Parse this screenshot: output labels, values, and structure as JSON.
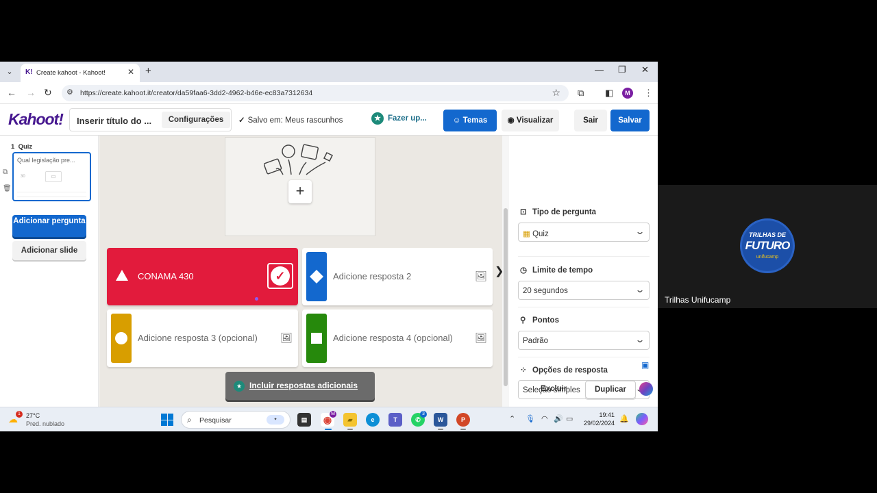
{
  "browser": {
    "tab_title": "Create kahoot - Kahoot!",
    "tab_favicon": "K!",
    "url": "https://create.kahoot.it/creator/da59faa6-3dd2-4962-b46e-ec83a7312634",
    "profile_initial": "M"
  },
  "header": {
    "logo": "Kahoot!",
    "title_placeholder": "Inserir título do ...",
    "settings_label": "Configurações",
    "saved_status": "Salvo em: Meus rascunhos",
    "upgrade_label": "Fazer up...",
    "themes_label": "Temas",
    "preview_label": "Visualizar",
    "exit_label": "Sair",
    "save_label": "Salvar"
  },
  "sidebar": {
    "slide_number": "1",
    "slide_type": "Quiz",
    "slide_question": "Qual legislação pre...",
    "slide_time": "30",
    "add_question_label": "Adicionar pergunta",
    "add_slide_label": "Adicionar slide"
  },
  "editor": {
    "answers": [
      {
        "text": "CONAMA 430",
        "color": "#e21b3c",
        "shape": "triangle",
        "correct": true
      },
      {
        "placeholder": "Adicione resposta 2",
        "color": "#1368ce",
        "shape": "diamond"
      },
      {
        "placeholder": "Adicione resposta 3 (opcional)",
        "color": "#d89e00",
        "shape": "circle"
      },
      {
        "placeholder": "Adicione resposta 4 (opcional)",
        "color": "#26890c",
        "shape": "square"
      }
    ],
    "more_answers_label": "Incluir respostas adicionais"
  },
  "panel": {
    "question_type_title": "Tipo de pergunta",
    "question_type_value": "Quiz",
    "time_limit_title": "Limite de tempo",
    "time_limit_value": "20 segundos",
    "points_title": "Pontos",
    "points_value": "Padrão",
    "answer_options_title": "Opções de resposta",
    "answer_options_value": "Seleção simples",
    "delete_label": "Excluir",
    "duplicate_label": "Duplicar"
  },
  "taskbar": {
    "weather_badge": "1",
    "temperature": "27°C",
    "weather_desc": "Pred. nublado",
    "search_placeholder": "Pesquisar",
    "time": "19:41",
    "date": "29/02/2024"
  },
  "participant": {
    "name": "Trilhas Unifucamp",
    "logo_line1": "TRILHAS DE",
    "logo_line2": "FUTURO",
    "logo_line3": "unifucamp"
  }
}
